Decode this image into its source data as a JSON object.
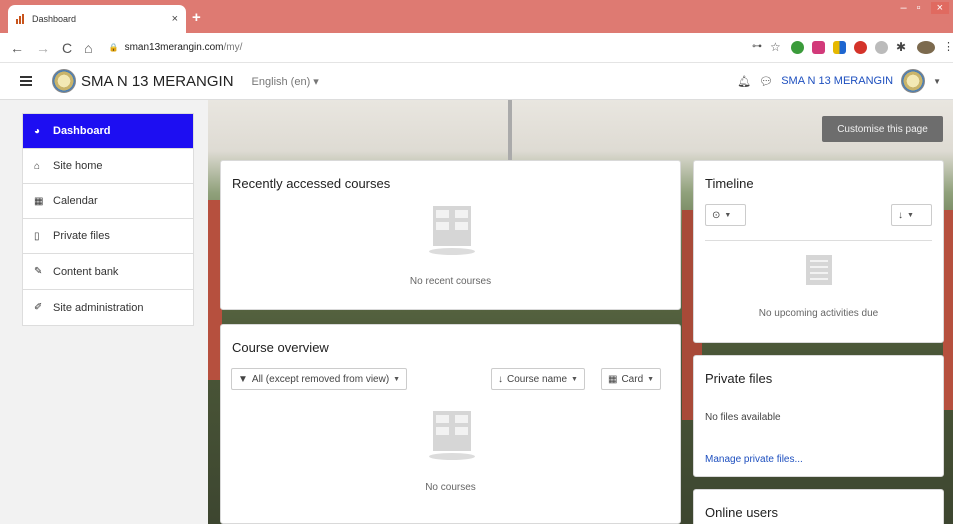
{
  "browser": {
    "tab_title": "Dashboard",
    "tab_close": "×",
    "new_tab": "+",
    "url_host": "sman13merangin.com",
    "url_path": "/my/"
  },
  "navbar": {
    "site_name": "SMA N 13 MERANGIN",
    "language": "English (en) ▾",
    "user_name": "SMA N 13 MERANGIN"
  },
  "sidebar": {
    "items": [
      {
        "label": "Dashboard",
        "icon": "dashboard-icon"
      },
      {
        "label": "Site home",
        "icon": "home-icon"
      },
      {
        "label": "Calendar",
        "icon": "calendar-icon"
      },
      {
        "label": "Private files",
        "icon": "file-icon"
      },
      {
        "label": "Content bank",
        "icon": "paint-brush-icon"
      }
    ],
    "admin": {
      "label": "Site administration",
      "icon": "wrench-icon"
    }
  },
  "customise_button": "Customise this page",
  "recent": {
    "title": "Recently accessed courses",
    "empty": "No recent courses"
  },
  "overview": {
    "title": "Course overview",
    "filter": "All (except removed from view)",
    "sort": "Course name",
    "view": "Card",
    "empty": "No courses"
  },
  "timeline": {
    "title": "Timeline",
    "empty": "No upcoming activities due"
  },
  "private_files": {
    "title": "Private files",
    "empty": "No files available",
    "manage_link": "Manage private files..."
  },
  "online_users": {
    "title": "Online users"
  }
}
